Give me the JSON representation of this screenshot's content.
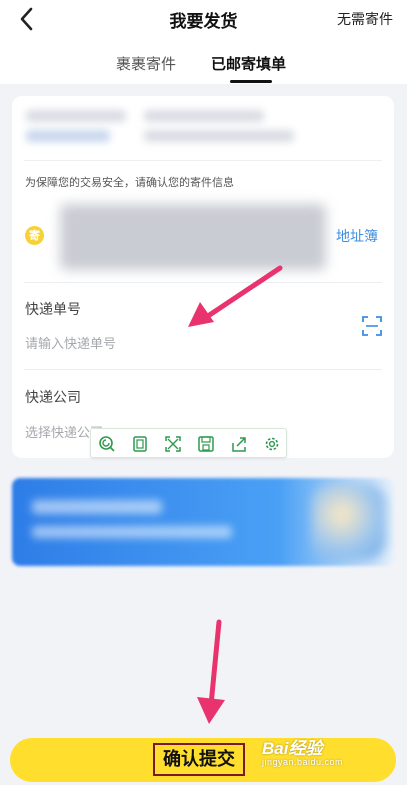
{
  "header": {
    "title": "我要发货",
    "right_action": "无需寄件",
    "tabs": [
      {
        "label": "裹裹寄件",
        "active": false
      },
      {
        "label": "已邮寄填单",
        "active": true
      }
    ]
  },
  "form": {
    "security_hint": "为保障您的交易安全，请确认您的寄件信息",
    "sender_badge": "寄",
    "address_book_link": "地址簿",
    "tracking_number": {
      "label": "快递单号",
      "placeholder": "请输入快递单号"
    },
    "courier_company": {
      "label": "快递公司",
      "placeholder": "选择快递公司"
    }
  },
  "floating_toolbar": {
    "icons": [
      "search-icon",
      "copy-icon",
      "fullscreen-icon",
      "save-icon",
      "share-icon",
      "settings-icon"
    ]
  },
  "footer": {
    "submit_label": "确认提交"
  },
  "watermark": {
    "main": "Bai经验",
    "sub": "jingyan.baidu.com"
  },
  "colors": {
    "accent_yellow": "#ffde2e",
    "link_blue": "#3b8ee0",
    "arrow_pink": "#e8336e",
    "badge_yellow": "#f5d23a"
  }
}
